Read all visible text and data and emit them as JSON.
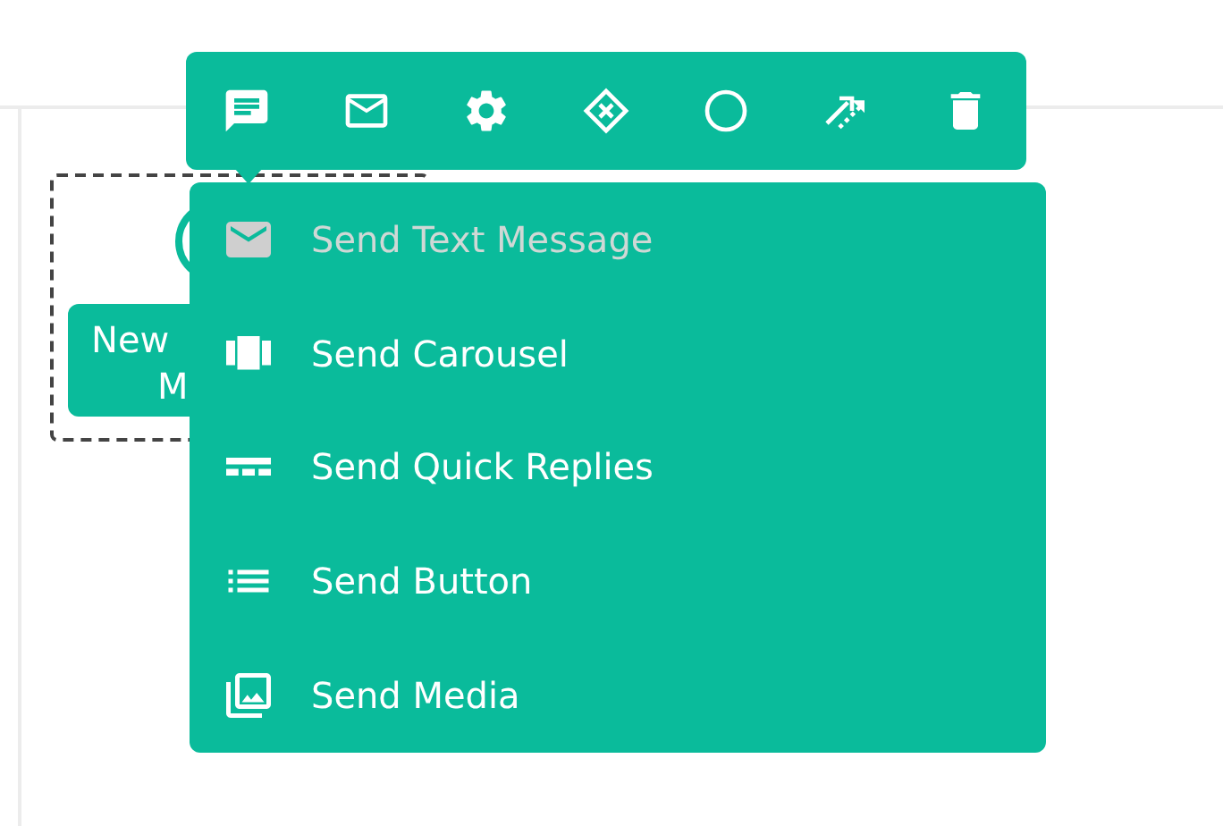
{
  "node": {
    "label_lines": [
      "New",
      "M"
    ]
  },
  "toolbar": {
    "buttons": [
      {
        "kind": "chat"
      },
      {
        "kind": "mail"
      },
      {
        "kind": "settings"
      },
      {
        "kind": "condition"
      },
      {
        "kind": "end"
      },
      {
        "kind": "connect"
      },
      {
        "kind": "delete"
      }
    ]
  },
  "menu": {
    "items": [
      {
        "label": "Send Text Message",
        "kind": "text",
        "disabled": true
      },
      {
        "label": "Send Carousel",
        "kind": "carousel",
        "disabled": false
      },
      {
        "label": "Send Quick Replies",
        "kind": "quick",
        "disabled": false
      },
      {
        "label": "Send Button",
        "kind": "button",
        "disabled": false
      },
      {
        "label": "Send Media",
        "kind": "media",
        "disabled": false
      }
    ]
  }
}
